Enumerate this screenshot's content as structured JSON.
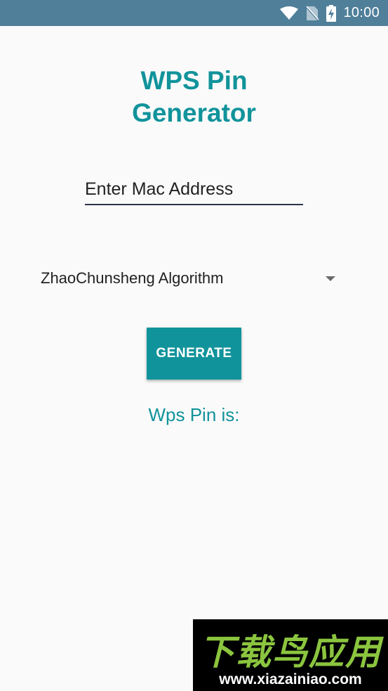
{
  "status_bar": {
    "time": "10:00",
    "icons": [
      "wifi-icon",
      "no-sim-icon",
      "battery-charging-icon"
    ],
    "background_color": "#4f7f99"
  },
  "title": {
    "line1": "WPS Pin",
    "line2": "Generator",
    "color": "#11939b"
  },
  "mac_field": {
    "value": "",
    "placeholder": "Enter Mac Address"
  },
  "algorithm_spinner": {
    "selected": "ZhaoChunsheng Algorithm"
  },
  "generate_button": {
    "label": "GENERATE",
    "color": "#11939b"
  },
  "result": {
    "label": "Wps Pin is:"
  },
  "watermark": {
    "logo_text": "下载鸟应用",
    "url": "www.xiazainiao.com"
  }
}
